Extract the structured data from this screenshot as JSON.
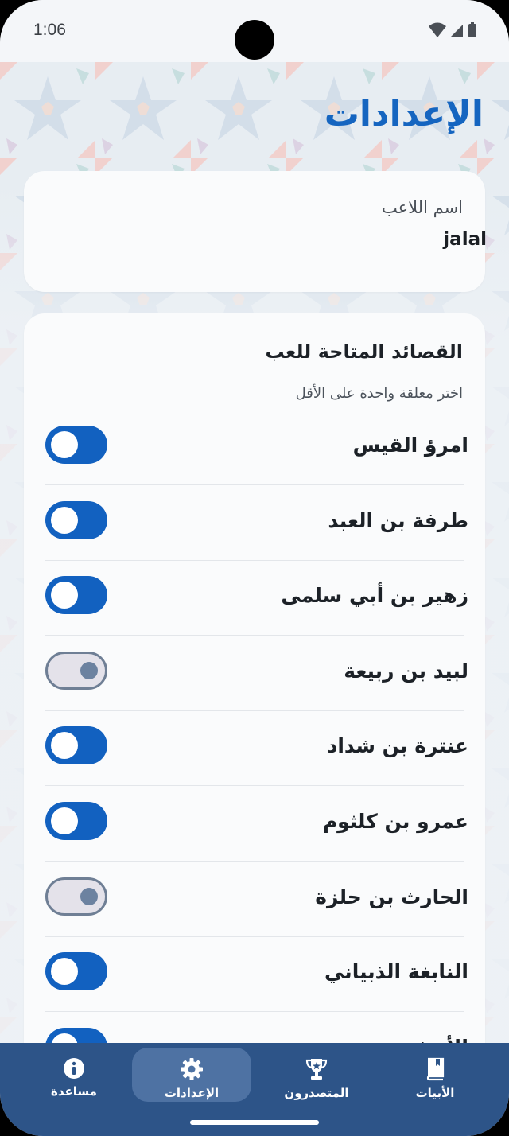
{
  "status_bar": {
    "time": "1:06"
  },
  "page_title": "الإعدادات",
  "player": {
    "label": "اسم اللاعب",
    "value": "jalal"
  },
  "poems": {
    "title": "القصائد المتاحة للعب",
    "subtitle": "اختر معلقة واحدة على الأقل",
    "items": [
      {
        "name": "امرؤ القيس",
        "enabled": true
      },
      {
        "name": "طرفة بن العبد",
        "enabled": true
      },
      {
        "name": "زهير بن أبي سلمى",
        "enabled": true
      },
      {
        "name": "لبيد بن ربيعة",
        "enabled": false
      },
      {
        "name": "عنترة بن شداد",
        "enabled": true
      },
      {
        "name": "عمرو بن كلثوم",
        "enabled": true
      },
      {
        "name": "الحارث بن حلزة",
        "enabled": false
      },
      {
        "name": "النابغة الذبياني",
        "enabled": true
      },
      {
        "name": "الأعشى",
        "enabled": true
      }
    ]
  },
  "nav": {
    "help": "مساعدة",
    "settings": "الإعدادات",
    "leaderboard": "المتصدرون",
    "verses": "الأبيات"
  },
  "colors": {
    "accent": "#1565c0",
    "toggle_on": "#1261c0",
    "nav_bg": "#2d5488",
    "nav_active": "#4e72a3"
  }
}
